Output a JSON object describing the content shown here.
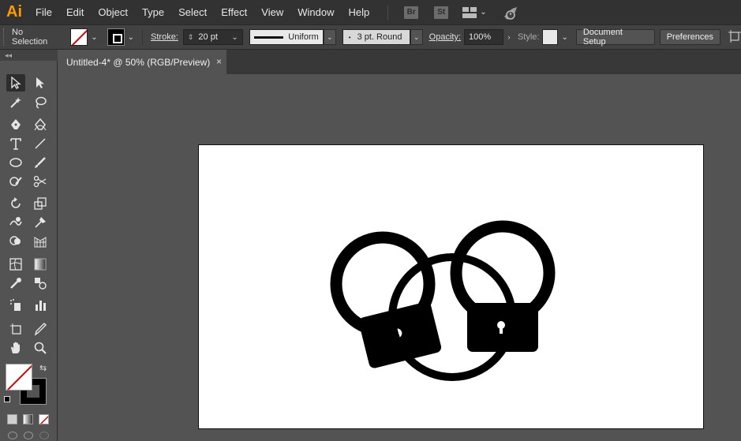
{
  "app": {
    "logo": "Ai"
  },
  "menu": [
    "File",
    "Edit",
    "Object",
    "Type",
    "Select",
    "Effect",
    "View",
    "Window",
    "Help"
  ],
  "app_badges": [
    "Br",
    "St"
  ],
  "control": {
    "selection_label": "No Selection",
    "stroke_label": "Stroke:",
    "stroke_value": "20 pt",
    "profile_value": "Uniform",
    "brush_value": "3 pt. Round",
    "opacity_label": "Opacity:",
    "opacity_value": "100%",
    "style_label": "Style:",
    "document_setup": "Document Setup",
    "preferences": "Preferences"
  },
  "tools_collapse": "◂◂",
  "document_tab": {
    "title": "Untitled-4* @ 50% (RGB/Preview)",
    "close": "×"
  },
  "colors": {
    "ui_dark": "#323232",
    "ui_mid": "#535353",
    "panel": "#424242",
    "accent": "#ff9a00",
    "artboard": "#ffffff",
    "artwork": "#000000",
    "none_swatch": "#d60000"
  },
  "tools": [
    "selection-tool",
    "direct-selection-tool",
    "magic-wand-tool",
    "lasso-tool",
    "pen-tool",
    "curvature-tool",
    "type-tool",
    "line-segment-tool",
    "ellipse-tool",
    "paintbrush-tool",
    "shaper-tool",
    "scissors-tool",
    "rotate-tool",
    "scale-tool",
    "warp-tool",
    "free-transform-tool",
    "shape-builder-tool",
    "perspective-grid-tool",
    "mesh-tool",
    "gradient-tool",
    "eyedropper-tool",
    "blend-tool",
    "symbol-sprayer-tool",
    "column-graph-tool",
    "artboard-tool",
    "slice-tool",
    "hand-tool",
    "zoom-tool"
  ]
}
